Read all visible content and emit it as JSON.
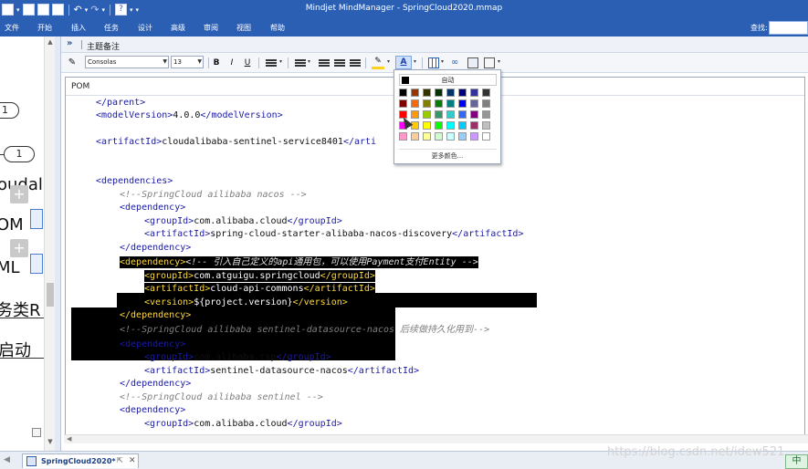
{
  "titlebar": {
    "title": "Mindjet MindManager - SpringCloud2020.mmap",
    "quick_access_icons": [
      "new-icon",
      "open-icon",
      "save-icon",
      "print-icon",
      "undo-icon",
      "redo-icon",
      "help-icon"
    ]
  },
  "ribbon": {
    "tabs": [
      "文件",
      "开始",
      "插入",
      "任务",
      "设计",
      "高级",
      "审阅",
      "视图",
      "帮助"
    ],
    "search_label": "查找:",
    "search_value": ""
  },
  "map": {
    "pill1": "1",
    "pill2": "1",
    "text1": "oudal",
    "text2": "OM",
    "text3": "ML",
    "text4": "务类R",
    "text5": "启动",
    "text6": ")"
  },
  "notes": {
    "header_label": "主题备注",
    "font_name": "Consolas",
    "font_size": "13",
    "bold": "B",
    "italic": "I",
    "underline": "U",
    "editor_title": "POM"
  },
  "code_lines": [
    "</parent>",
    "<modelVersion>4.0.0</modelVersion>",
    "<artifactId>cloudalibaba-sentinel-service8401</arti",
    "<dependencies>",
    "<!--SpringCloud ailibaba nacos -->",
    "<dependency>",
    "<groupId>com.alibaba.cloud</groupId>",
    "<artifactId>spring-cloud-starter-alibaba-nacos-discovery</artifactId>",
    "</dependency>",
    "<dependency><!-- 引入自己定义的api通用包，可以使用Payment支付Entity -->",
    "<groupId>com.atguigu.springcloud</groupId>",
    "<artifactId>cloud-api-commons</artifactId>",
    "<version>${project.version}</version>",
    "</dependency>",
    "<!--SpringCloud ailibaba sentinel-datasource-nacos 后续做持久化用到-->",
    "<dependency>",
    "<groupId>com.alibaba.csp</groupId>",
    "<artifactId>sentinel-datasource-nacos</artifactId>",
    "</dependency>",
    "<!--SpringCloud ailibaba sentinel -->",
    "<dependency>",
    "<groupId>com.alibaba.cloud</groupId>"
  ],
  "color_popup": {
    "auto_label": "自动",
    "more_label": "更多颜色...",
    "swatches": [
      "#000000",
      "#993300",
      "#333300",
      "#003300",
      "#003366",
      "#000080",
      "#333399",
      "#333333",
      "#800000",
      "#ff6600",
      "#808000",
      "#008000",
      "#008080",
      "#0000ff",
      "#666699",
      "#808080",
      "#ff0000",
      "#ff9900",
      "#99cc00",
      "#339966",
      "#33cccc",
      "#3366ff",
      "#800080",
      "#969696",
      "#ff00ff",
      "#ffcc00",
      "#ffff00",
      "#00ff00",
      "#00ffff",
      "#00ccff",
      "#993366",
      "#c0c0c0",
      "#ff99cc",
      "#ffcc99",
      "#ffff99",
      "#ccffcc",
      "#ccffff",
      "#99ccff",
      "#cc99ff",
      "#ffffff"
    ]
  },
  "bottom": {
    "doc_tab": "SpringCloud2020*",
    "watermark": "https://blog.csdn.net/idew521",
    "ime": "中"
  }
}
